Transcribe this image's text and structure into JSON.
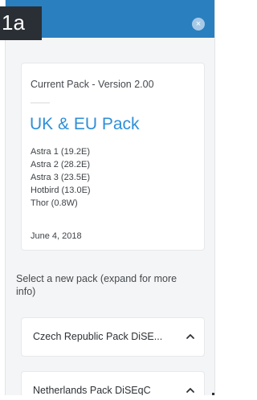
{
  "header": {
    "step": "1a",
    "close_label": "×"
  },
  "current_pack": {
    "title": "Current Pack - Version 2.00",
    "name": "UK & EU Pack",
    "satellites": [
      "Astra 1 (19.2E)",
      "Astra 2 (28.2E)",
      "Astra 3 (23.5E)",
      "Hotbird (13.0E)",
      "Thor (0.8W)"
    ],
    "date": "June 4, 2018"
  },
  "select": {
    "prompt": "Select a new pack (expand for more info)",
    "options": [
      {
        "label": "Czech Republic Pack DiSE..."
      },
      {
        "label": "Netherlands Pack DiSEqC"
      }
    ]
  },
  "colors": {
    "header": "#2a7fbf",
    "badge": "#2a2f35",
    "accent": "#2f8fd8",
    "background": "#f4f5f6"
  }
}
